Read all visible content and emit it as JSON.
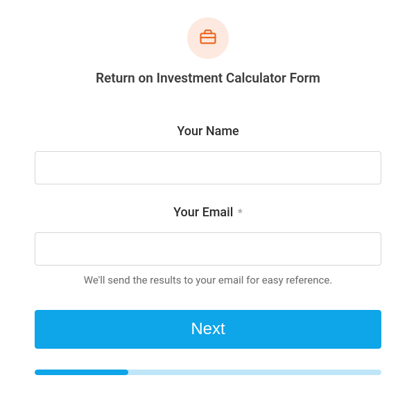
{
  "header": {
    "title": "Return on Investment Calculator Form"
  },
  "fields": {
    "name": {
      "label": "Your Name",
      "value": ""
    },
    "email": {
      "label": "Your Email",
      "required_mark": "*",
      "value": "",
      "helper": "We'll send the results to your email for easy reference."
    }
  },
  "actions": {
    "next_label": "Next"
  },
  "progress": {
    "percent": 27
  }
}
